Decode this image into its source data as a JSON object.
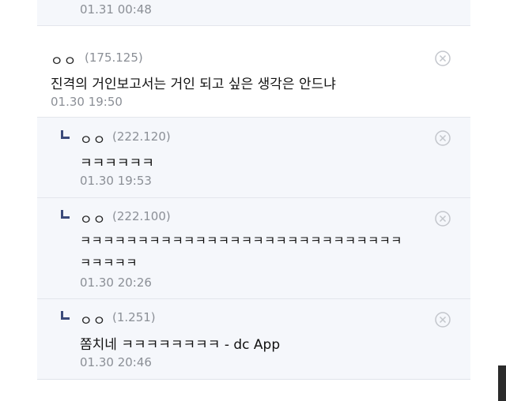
{
  "comments": {
    "top": {
      "timestamp": "01.31 00:48"
    },
    "main": {
      "nickname": "ㅇㅇ",
      "ip": "(175.125)",
      "text": "진격의 거인보고서는 거인 되고 싶은 생각은 안드냐",
      "timestamp": "01.30 19:50"
    },
    "replies": [
      {
        "nickname": "ㅇㅇ",
        "ip": "(222.120)",
        "text": "ㅋㅋㅋㅋㅋㅋ",
        "timestamp": "01.30 19:53"
      },
      {
        "nickname": "ㅇㅇ",
        "ip": "(222.100)",
        "text_line1": "ㅋㅋㅋㅋㅋㅋㅋㅋㅋㅋㅋㅋㅋㅋㅋㅋㅋㅋㅋㅋㅋㅋㅋㅋㅋㅋㅋㅋ",
        "text_line2": "ㅋㅋㅋㅋㅋ",
        "timestamp": "01.30 20:26"
      },
      {
        "nickname": "ㅇㅇ",
        "ip": "(1.251)",
        "text": "쫌치네 ㅋㅋㅋㅋㅋㅋㅋㅋ - dc App",
        "timestamp": "01.30 20:46"
      }
    ]
  },
  "icons": {
    "delete": "close-circle-icon",
    "reply": "reply-arrow-icon"
  },
  "colors": {
    "reply_bg": "#f5f7fb",
    "reply_mark": "#3b4a7a",
    "meta_text": "#8b8f96"
  }
}
